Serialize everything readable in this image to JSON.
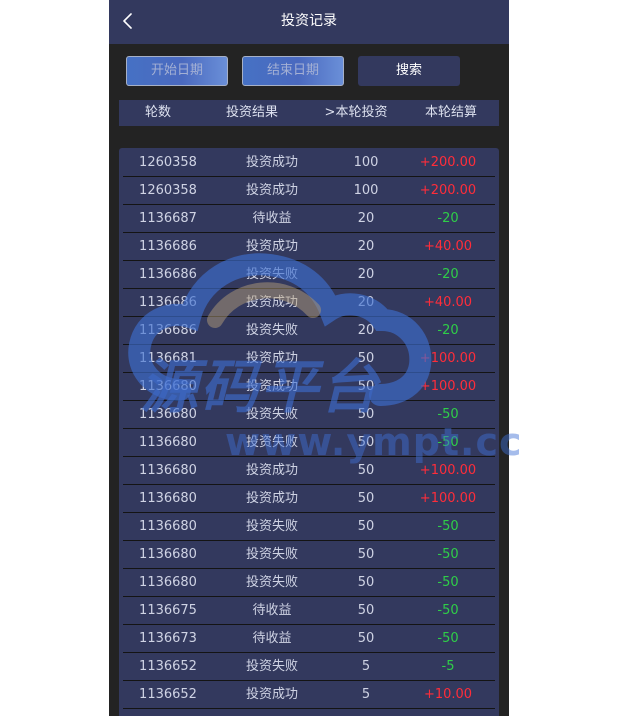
{
  "header": {
    "title": "投资记录",
    "back_icon": "chevron-left-icon"
  },
  "filters": {
    "start_label": "开始日期",
    "end_label": "结束日期",
    "search_label": "搜索"
  },
  "table": {
    "columns": [
      "轮数",
      "投资结果",
      ">本轮投资",
      "本轮结算"
    ],
    "rows": [
      {
        "round": "1260358",
        "result": "投资成功",
        "amount": "100",
        "settle": "+200.00",
        "sign": "pos"
      },
      {
        "round": "1260358",
        "result": "投资成功",
        "amount": "100",
        "settle": "+200.00",
        "sign": "pos"
      },
      {
        "round": "1136687",
        "result": "待收益",
        "amount": "20",
        "settle": "-20",
        "sign": "neg"
      },
      {
        "round": "1136686",
        "result": "投资成功",
        "amount": "20",
        "settle": "+40.00",
        "sign": "pos"
      },
      {
        "round": "1136686",
        "result": "投资失败",
        "amount": "20",
        "settle": "-20",
        "sign": "neg"
      },
      {
        "round": "1136686",
        "result": "投资成功",
        "amount": "20",
        "settle": "+40.00",
        "sign": "pos"
      },
      {
        "round": "1136686",
        "result": "投资失败",
        "amount": "20",
        "settle": "-20",
        "sign": "neg"
      },
      {
        "round": "1136681",
        "result": "投资成功",
        "amount": "50",
        "settle": "+100.00",
        "sign": "pos"
      },
      {
        "round": "1136680",
        "result": "投资成功",
        "amount": "50",
        "settle": "+100.00",
        "sign": "pos"
      },
      {
        "round": "1136680",
        "result": "投资失败",
        "amount": "50",
        "settle": "-50",
        "sign": "neg"
      },
      {
        "round": "1136680",
        "result": "投资失败",
        "amount": "50",
        "settle": "-50",
        "sign": "neg"
      },
      {
        "round": "1136680",
        "result": "投资成功",
        "amount": "50",
        "settle": "+100.00",
        "sign": "pos"
      },
      {
        "round": "1136680",
        "result": "投资成功",
        "amount": "50",
        "settle": "+100.00",
        "sign": "pos"
      },
      {
        "round": "1136680",
        "result": "投资失败",
        "amount": "50",
        "settle": "-50",
        "sign": "neg"
      },
      {
        "round": "1136680",
        "result": "投资失败",
        "amount": "50",
        "settle": "-50",
        "sign": "neg"
      },
      {
        "round": "1136680",
        "result": "投资失败",
        "amount": "50",
        "settle": "-50",
        "sign": "neg"
      },
      {
        "round": "1136675",
        "result": "待收益",
        "amount": "50",
        "settle": "-50",
        "sign": "neg"
      },
      {
        "round": "1136673",
        "result": "待收益",
        "amount": "50",
        "settle": "-50",
        "sign": "neg"
      },
      {
        "round": "1136652",
        "result": "投资失败",
        "amount": "5",
        "settle": "-5",
        "sign": "neg"
      },
      {
        "round": "1136652",
        "result": "投资成功",
        "amount": "5",
        "settle": "+10.00",
        "sign": "pos"
      }
    ]
  },
  "watermark": {
    "text_cn": "源码平台",
    "text_url": "www.ympt.cc"
  },
  "colors": {
    "header_bg": "#33395e",
    "page_bg": "#232323",
    "positive": "#ff2d3a",
    "negative": "#2fce48"
  }
}
